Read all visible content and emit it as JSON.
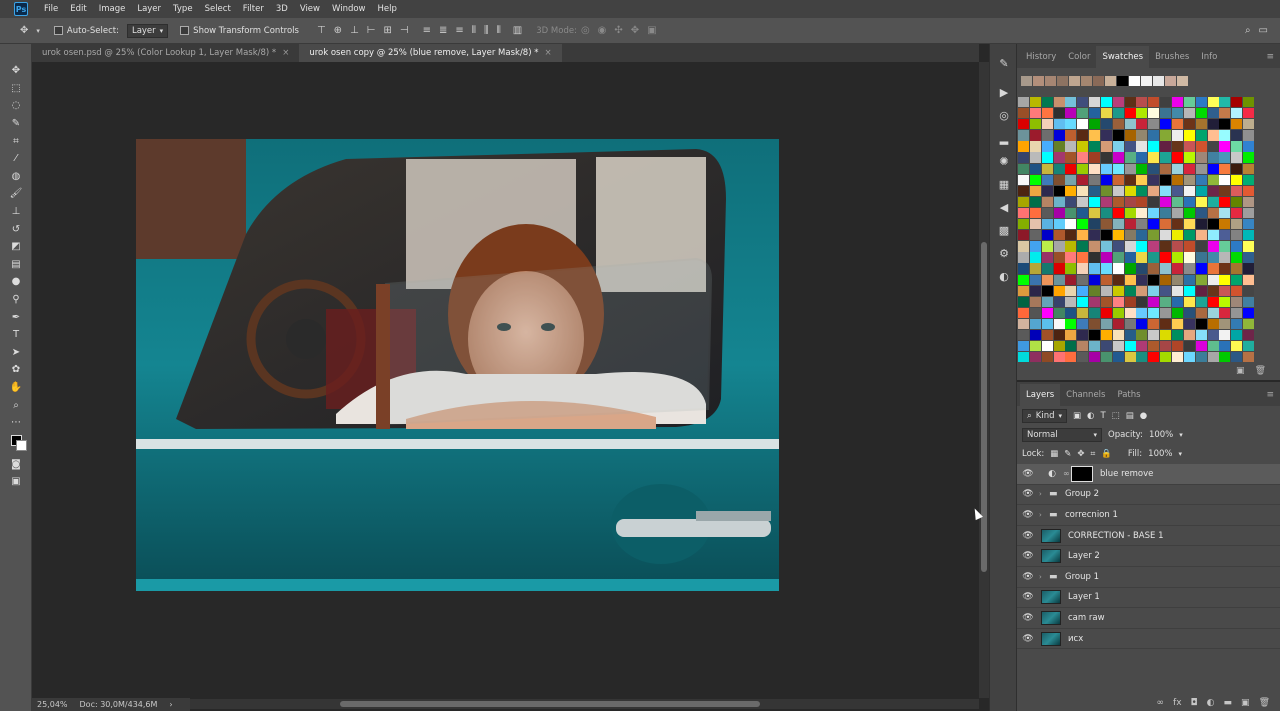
{
  "app": {
    "logo": "Ps"
  },
  "menu": [
    "File",
    "Edit",
    "Image",
    "Layer",
    "Type",
    "Select",
    "Filter",
    "3D",
    "View",
    "Window",
    "Help"
  ],
  "options": {
    "move_icon": "move-icon",
    "auto_select_label": "Auto-Select:",
    "auto_select_target": "Layer",
    "show_transform_label": "Show Transform Controls",
    "mode_3d_label": "3D Mode:"
  },
  "tabs": [
    {
      "label": "urok osen.psd @ 25% (Color Lookup 1, Layer Mask/8) *",
      "active": false
    },
    {
      "label": "urok osen copy @ 25% (blue remove, Layer Mask/8) *",
      "active": true
    }
  ],
  "status": {
    "zoom": "25,04%",
    "doc": "Doc: 30,0M/434,6M"
  },
  "panel_top": {
    "tabs": [
      "History",
      "Color",
      "Swatches",
      "Brushes",
      "Info"
    ],
    "active_tab": "Swatches",
    "recent_swatches": [
      "#a7998b",
      "#b38f7b",
      "#a68673",
      "#8d7362",
      "#bfa690",
      "#a48670",
      "#8a6a58",
      "#c9b19a",
      "#000000",
      "#ffffff",
      "#f2f2f2",
      "#e8e8e8",
      "#c8a89a",
      "#d0b9a4"
    ],
    "swatch_palette": [
      "#ffffff",
      "#e8e8e8",
      "#c8c8c8",
      "#8b8b8b",
      "#4a4a4a",
      "#000000",
      "#ff0000",
      "#ffff00",
      "#00ff00",
      "#00ffff",
      "#0000ff",
      "#ff00ff",
      "#ff9900",
      "#99cc00",
      "#009966",
      "#336699",
      "#993366",
      "#cc6633",
      "#66cc99",
      "#ccbb99",
      "#f5d0b8",
      "#e6a77f",
      "#c47a4a",
      "#8f4a24",
      "#5a2a14",
      "#2a72b8",
      "#3b8fd1",
      "#5ab2e0",
      "#7dd0ea",
      "#a6e2ee",
      "#ff6b6b",
      "#ffb347",
      "#fde74c",
      "#9bc53d",
      "#5bc0eb",
      "#404e7c",
      "#d7263d",
      "#f46036",
      "#2e294e",
      "#1b998b"
    ]
  },
  "panel_layers": {
    "tabs": [
      "Layers",
      "Channels",
      "Paths"
    ],
    "active_tab": "Layers",
    "filter_label": "Kind",
    "blend_mode": "Normal",
    "opacity_label": "Opacity:",
    "opacity_value": "100%",
    "lock_label": "Lock:",
    "fill_label": "Fill:",
    "fill_value": "100%",
    "layers": [
      {
        "name": "blue remove",
        "type": "adjustment",
        "selected": true
      },
      {
        "name": "Group 2",
        "type": "group"
      },
      {
        "name": "correcnion 1",
        "type": "group"
      },
      {
        "name": "CORRECTION - BASE 1",
        "type": "image"
      },
      {
        "name": "Layer 2",
        "type": "image"
      },
      {
        "name": "Group 1",
        "type": "group"
      },
      {
        "name": "Layer 1",
        "type": "image"
      },
      {
        "name": "cam raw",
        "type": "image"
      },
      {
        "name": "исх",
        "type": "image"
      }
    ]
  }
}
